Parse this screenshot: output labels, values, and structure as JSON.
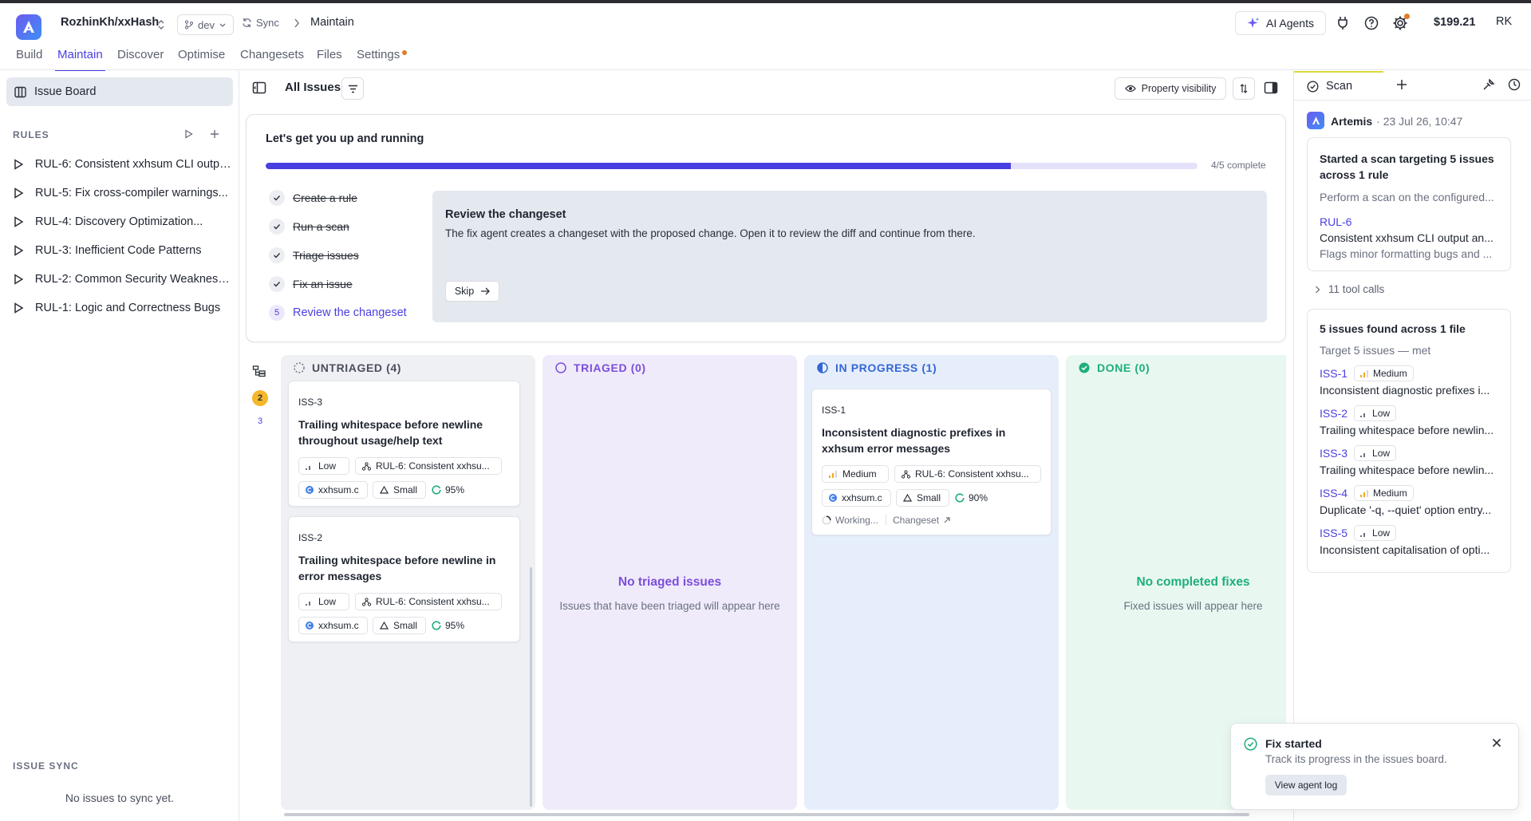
{
  "header": {
    "repo": "RozhinKh/xxHash",
    "branch": "dev",
    "sync_label": "Sync",
    "breadcrumb_current": "Maintain",
    "ai_agents_label": "AI Agents",
    "balance": "$199.21",
    "avatar_initials": "RK"
  },
  "tabs": [
    {
      "label": "Build"
    },
    {
      "label": "Maintain"
    },
    {
      "label": "Discover"
    },
    {
      "label": "Optimise"
    },
    {
      "label": "Changesets"
    },
    {
      "label": "Files"
    },
    {
      "label": "Settings"
    }
  ],
  "sidebar": {
    "board_label": "Issue Board",
    "rules_label": "RULES",
    "rules": [
      {
        "label": "RUL-6: Consistent xxhsum CLI outpu..."
      },
      {
        "label": "RUL-5: Fix cross-compiler warnings..."
      },
      {
        "label": "RUL-4: Discovery Optimization..."
      },
      {
        "label": "RUL-3: Inefficient Code Patterns"
      },
      {
        "label": "RUL-2: Common Security Weaknesses"
      },
      {
        "label": "RUL-1: Logic and Correctness Bugs"
      }
    ],
    "issue_sync_label": "ISSUE SYNC",
    "issue_sync_empty": "No issues to sync yet."
  },
  "main": {
    "title": "All Issues",
    "property_visibility": "Property visibility"
  },
  "onboarding": {
    "title": "Let's get you up and running",
    "progress": 0.8,
    "progress_text": "4/5 complete",
    "steps": [
      {
        "label": "Create a rule",
        "done": true
      },
      {
        "label": "Run a scan",
        "done": true
      },
      {
        "label": "Triage issues",
        "done": true
      },
      {
        "label": "Fix an issue",
        "done": true
      },
      {
        "label": "Review the changeset",
        "done": false,
        "number": "5"
      }
    ],
    "detail_title": "Review the changeset",
    "detail_text": "The fix agent creates a changeset with the proposed change. Open it to review the diff and continue from there.",
    "skip_label": "Skip"
  },
  "lanes": {
    "badge_1": "2",
    "badge_2": "3"
  },
  "columns": {
    "untriaged": {
      "header": "UNTRIAGED (4)",
      "cards": [
        {
          "id": "ISS-3",
          "title": "Trailing whitespace before newline throughout usage/help text",
          "severity": "Low",
          "rule": "RUL-6: Consistent xxhsu...",
          "file": "xxhsum.c",
          "size": "Small",
          "confidence": "95%"
        },
        {
          "id": "ISS-2",
          "title": "Trailing whitespace before newline in error messages",
          "severity": "Low",
          "rule": "RUL-6: Consistent xxhsu...",
          "file": "xxhsum.c",
          "size": "Small",
          "confidence": "95%"
        }
      ]
    },
    "triaged": {
      "header": "TRIAGED (0)",
      "empty_title": "No triaged issues",
      "empty_sub": "Issues that have been triaged will appear here"
    },
    "in_progress": {
      "header": "IN PROGRESS (1)",
      "card": {
        "id": "ISS-1",
        "title": "Inconsistent diagnostic prefixes in xxhsum error messages",
        "severity": "Medium",
        "rule": "RUL-6: Consistent xxhsu...",
        "file": "xxhsum.c",
        "size": "Small",
        "confidence": "90%",
        "status": "Working...",
        "changeset": "Changeset"
      }
    },
    "done": {
      "header": "DONE (0)",
      "empty_title": "No completed fixes",
      "empty_sub": "Fixed issues will appear here"
    }
  },
  "right_panel": {
    "tab_label": "Scan",
    "author": "Artemis",
    "timestamp": "· 23 Jul 26, 10:47",
    "scan_card": {
      "title": "Started a scan targeting 5 issues across 1 rule",
      "desc": "Perform a scan on the configured...",
      "rule_id": "RUL-6",
      "rule_title": "Consistent xxhsum CLI output an...",
      "rule_desc": "Flags minor formatting bugs and ..."
    },
    "tool_calls": "11 tool calls",
    "results_card": {
      "title": "5 issues found across 1 file",
      "subtitle": "Target 5 issues — met",
      "issues": [
        {
          "id": "ISS-1",
          "severity": "Medium",
          "title": "Inconsistent diagnostic prefixes i..."
        },
        {
          "id": "ISS-2",
          "severity": "Low",
          "title": "Trailing whitespace before newlin..."
        },
        {
          "id": "ISS-3",
          "severity": "Low",
          "title": "Trailing whitespace before newlin..."
        },
        {
          "id": "ISS-4",
          "severity": "Medium",
          "title": "Duplicate '-q, --quiet' option entry..."
        },
        {
          "id": "ISS-5",
          "severity": "Low",
          "title": "Inconsistent capitalisation of opti..."
        }
      ]
    }
  },
  "toast": {
    "title": "Fix started",
    "message": "Track its progress in the issues board.",
    "button": "View agent log"
  },
  "colors": {
    "accent": "#4a3fe0",
    "untriaged_bg": "#eef0f4",
    "triaged_bg": "#efebfb",
    "triaged_text": "#7c4ddb",
    "in_progress_bg": "#e6eefb",
    "in_progress_text": "#3566d6",
    "done_bg": "#e8f8f1",
    "done_text": "#1fae7c",
    "settings_dot": "#e07b2a"
  }
}
